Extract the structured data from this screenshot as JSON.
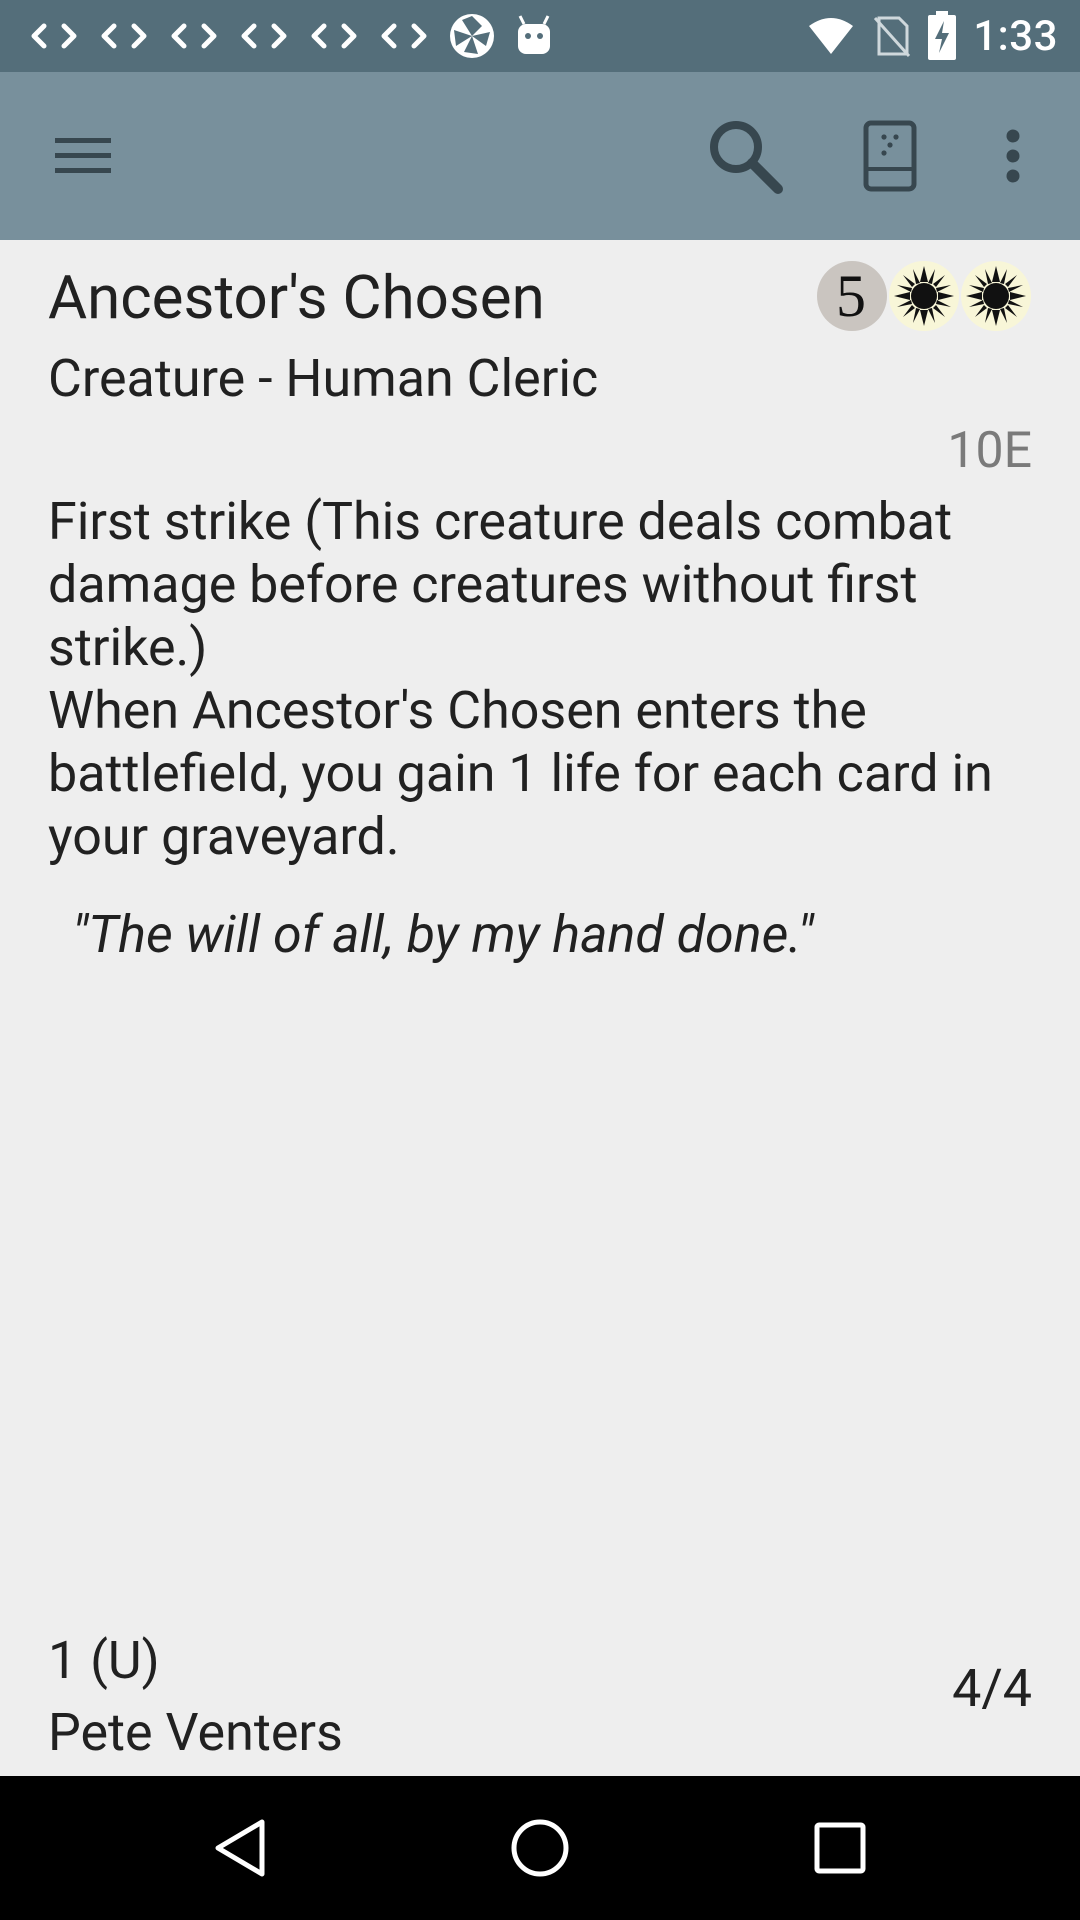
{
  "status_bar": {
    "time": "1:33",
    "left_icons": [
      "code-icon",
      "code-icon",
      "code-icon",
      "code-icon",
      "code-icon",
      "code-icon",
      "shutter-icon",
      "android-icon"
    ],
    "right_icons": [
      "wifi-icon",
      "no-sim-icon",
      "battery-charging-icon"
    ]
  },
  "toolbar": {
    "icons": [
      "menu-icon",
      "search-icon",
      "deck-icon",
      "more-vert-icon"
    ],
    "background": "#78909c",
    "status_background": "#546e7a"
  },
  "card": {
    "name": "Ancestor's Chosen",
    "mana_cost": [
      "5",
      "W",
      "W"
    ],
    "type_line": "Creature - Human Cleric",
    "set_code": "10E",
    "rules_text": [
      "First strike (This creature deals combat damage before creatures without first strike.)",
      "When Ancestor's Chosen enters the battlefield, you gain 1 life for each card in your graveyard."
    ],
    "flavor_text": "\"The will of all, by my hand done.\"",
    "number_rarity": "1 (U)",
    "artist": "Pete Venters",
    "power_toughness": "4/4"
  },
  "nav_bar": {
    "icons": [
      "back-icon",
      "home-icon",
      "recents-icon"
    ]
  }
}
